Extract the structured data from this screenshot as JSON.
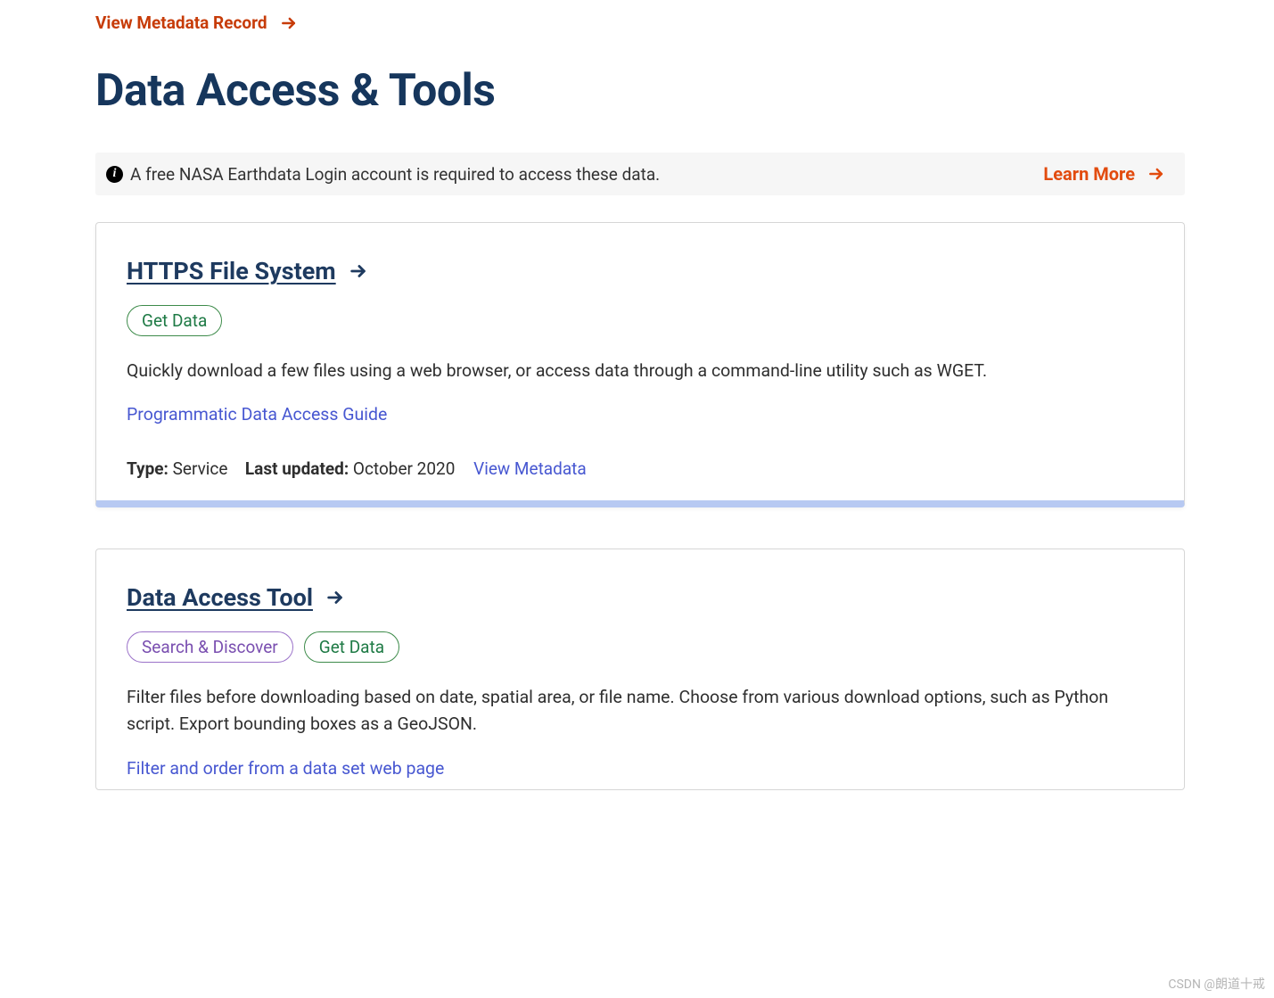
{
  "top_link": "View Metadata Record",
  "page_title": "Data Access & Tools",
  "notice": {
    "text": "A free NASA Earthdata Login account is required to access these data.",
    "learn_more": "Learn More"
  },
  "cards": [
    {
      "title": "HTTPS File System",
      "pills": [
        {
          "label": "Get Data",
          "style": "green"
        }
      ],
      "description": "Quickly download a few files using a web browser, or access data through a command-line utility such as WGET.",
      "link": "Programmatic Data Access Guide",
      "meta": {
        "type_label": "Type:",
        "type_value": "Service",
        "updated_label": "Last updated:",
        "updated_value": "October 2020",
        "view_metadata": "View Metadata"
      }
    },
    {
      "title": "Data Access Tool",
      "pills": [
        {
          "label": "Search & Discover",
          "style": "purple"
        },
        {
          "label": "Get Data",
          "style": "green"
        }
      ],
      "description": "Filter files before downloading based on date, spatial area, or file name. Choose from various download options, such as Python script. Export bounding boxes as a GeoJSON.",
      "link": "Filter and order from a data set web page"
    }
  ],
  "watermark": "CSDN @朗道十戒"
}
